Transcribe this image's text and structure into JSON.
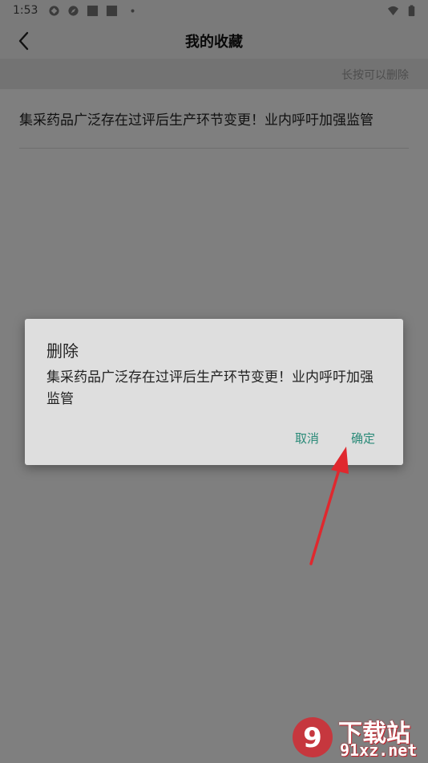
{
  "status_bar": {
    "time": "1:53",
    "icons": [
      "app-notification-icon",
      "compass-icon",
      "square-icon",
      "square-icon",
      "dot-icon"
    ],
    "right_icons": [
      "wifi-icon",
      "battery-icon"
    ]
  },
  "title_bar": {
    "back_icon": "chevron-left-icon",
    "title": "我的收藏"
  },
  "hint": "长按可以删除",
  "favorites": [
    {
      "title": "集采药品广泛存在过评后生产环节变更！业内呼吁加强监管"
    }
  ],
  "dialog": {
    "title": "删除",
    "message": "集采药品广泛存在过评后生产环节变更！业内呼吁加强监管",
    "cancel_label": "取消",
    "confirm_label": "确定"
  },
  "watermark": {
    "logo_text": "9",
    "cn": "下载站",
    "en": "91xz.net"
  },
  "colors": {
    "accent": "#2a8a78",
    "arrow": "#e0282e",
    "scrim": "rgba(0,0,0,0.5)",
    "dialog_bg": "#dedede"
  }
}
